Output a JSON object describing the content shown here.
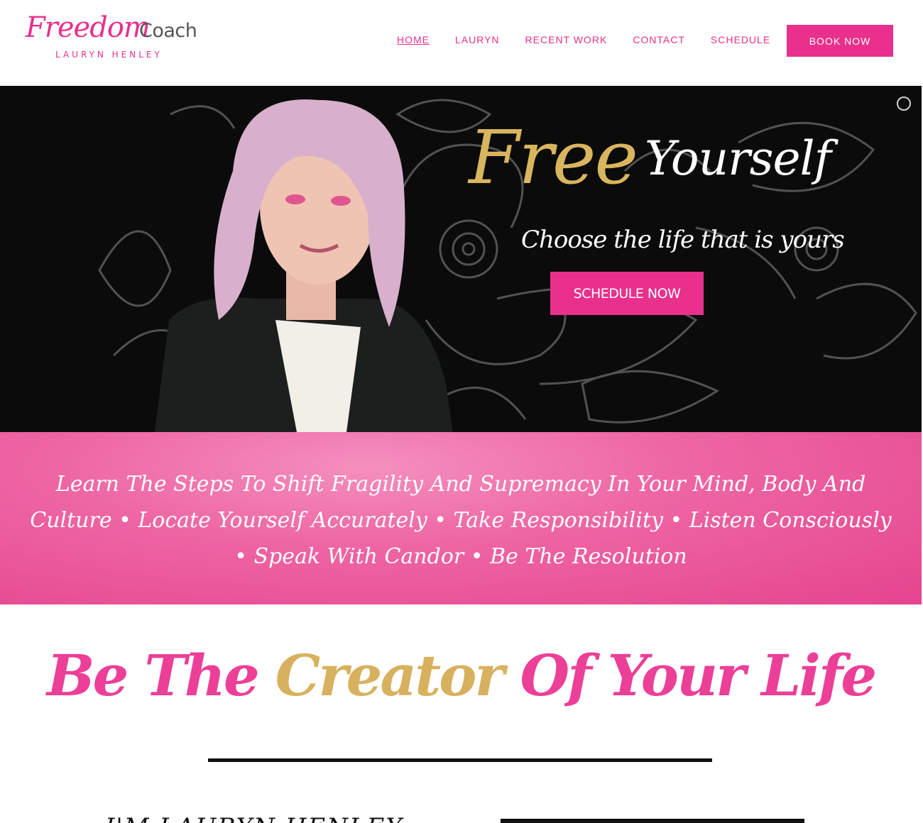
{
  "logo": {
    "name_script": "Freedom",
    "name_plain": "Coach",
    "subtitle": "LAURYN HENLEY"
  },
  "nav": {
    "items": [
      {
        "label": "HOME",
        "active": true
      },
      {
        "label": "LAURYN",
        "active": false
      },
      {
        "label": "RECENT WORK",
        "active": false
      },
      {
        "label": "CONTACT",
        "active": false
      },
      {
        "label": "SCHEDULE",
        "active": false
      }
    ],
    "cta": "BOOK NOW"
  },
  "hero": {
    "title_accent": "Free",
    "title_rest": "Yourself",
    "subtitle": "Choose the life that is yours",
    "button": "SCHEDULE NOW"
  },
  "band": {
    "text": "Learn The Steps To Shift Fragility And Supremacy In Your Mind, Body And Culture • Locate Yourself Accurately • Take Responsibility • Listen Consciously • Speak With Candor • Be The Resolution"
  },
  "headline": {
    "part1": "Be The",
    "part2": "Creator",
    "part3": "Of Your Life"
  },
  "intro_heading": "I'M LAURYN HENLEY",
  "colors": {
    "brand_pink": "#e8308c",
    "gold": "#d8b15e",
    "dark": "#0b0b0b"
  }
}
